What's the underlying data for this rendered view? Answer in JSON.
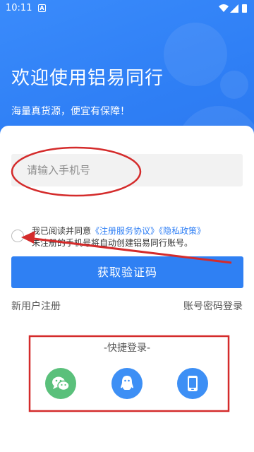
{
  "status_bar": {
    "time": "10:11",
    "notification_badge": "A"
  },
  "header": {
    "title": "欢迎使用铝易同行",
    "tagline": "海量真货源，便宜有保障！",
    "color": "#2f7ff5"
  },
  "login_form": {
    "phone_placeholder": "请输入手机号",
    "phone_value": "",
    "agreement_checked": false,
    "agreement_prefix": "我已阅读并同意",
    "service_agreement_link": "《注册服务协议》",
    "privacy_policy_link": "《隐私政策》",
    "agreement_note": "未注册的手机号将自动创建铝易同行账号。",
    "get_code_label": "获取验证码"
  },
  "links": {
    "register": "新用户注册",
    "password_login": "账号密码登录"
  },
  "quick_login": {
    "title": "-快捷登录-",
    "options": [
      {
        "icon": "wechat-icon",
        "color": "#5ac07b"
      },
      {
        "icon": "qq-icon",
        "color": "#3d8ff5"
      },
      {
        "icon": "phone-icon",
        "color": "#3d8ff5"
      }
    ]
  },
  "annotation_color": "#d42b2b"
}
